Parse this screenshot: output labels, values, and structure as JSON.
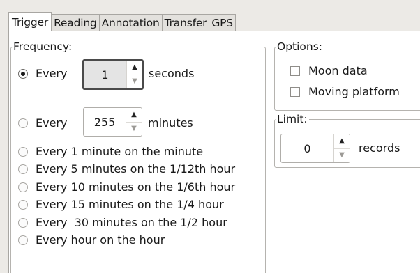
{
  "tabs": [
    {
      "label": "Trigger",
      "active": true
    },
    {
      "label": "Reading",
      "active": false
    },
    {
      "label": "Annotation",
      "active": false
    },
    {
      "label": "Transfer",
      "active": false
    },
    {
      "label": "GPS",
      "active": false
    }
  ],
  "frequency": {
    "title": "Frequency:",
    "every_seconds": {
      "prefix": "Every",
      "value": "1",
      "unit": "seconds",
      "checked": true
    },
    "every_minutes": {
      "prefix": "Every",
      "value": "255",
      "unit": "minutes",
      "checked": false
    },
    "options": [
      "Every 1 minute on the minute",
      "Every 5 minutes on the 1/12th hour",
      "Every 10 minutes on the 1/6th hour",
      "Every 15 minutes on the 1/4 hour",
      "Every  30 minutes on the 1/2 hour",
      "Every hour on the hour"
    ]
  },
  "options_group": {
    "title": "Options:",
    "moon_data": {
      "label": "Moon data",
      "checked": false
    },
    "moving_platform": {
      "label": "Moving platform",
      "checked": false
    }
  },
  "limit": {
    "title": "Limit:",
    "value": "0",
    "unit": "records"
  },
  "icons": {
    "spin_up": "up-arrow",
    "spin_down": "down-arrow"
  }
}
